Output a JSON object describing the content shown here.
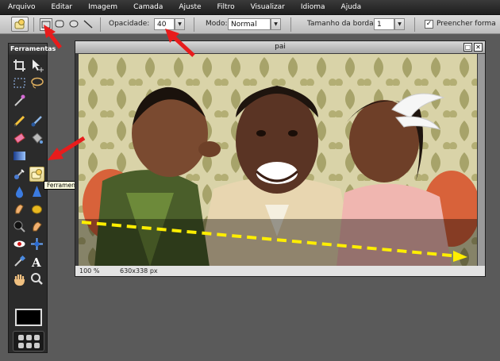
{
  "menu": [
    "Arquivo",
    "Editar",
    "Imagem",
    "Camada",
    "Ajuste",
    "Filtro",
    "Visualizar",
    "Idioma",
    "Ajuda"
  ],
  "options": {
    "opacity_label": "Opacidade:",
    "opacity_value": "40",
    "mode_label": "Modo:",
    "mode_value": "Normal",
    "border_label": "Tamanho da borda:",
    "border_value": "1",
    "fill_label": "Preencher forma",
    "fill_checked": true
  },
  "tools_panel": {
    "title": "Ferramentas",
    "tooltip": "Ferramenta Desenho",
    "text_tool_glyph": "A"
  },
  "image_window": {
    "title": "pai",
    "zoom": "100 %",
    "size": "630x338 px"
  },
  "annotation_colors": {
    "arrow": "#e81c1c",
    "dashed_line": "#ffee00"
  }
}
